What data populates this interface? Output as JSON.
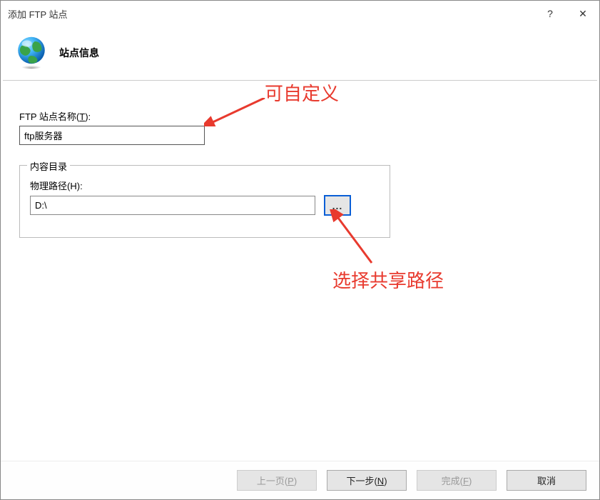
{
  "window": {
    "title": "添加 FTP 站点",
    "help_symbol": "?",
    "close_symbol": "✕"
  },
  "header": {
    "title": "站点信息"
  },
  "fields": {
    "site_name_label_prefix": "FTP 站点名称(",
    "site_name_label_shortcut": "T",
    "site_name_label_suffix": "):",
    "site_name_value": "ftp服务器",
    "content_dir_legend": "内容目录",
    "physical_path_label_prefix": "物理路径(",
    "physical_path_label_shortcut": "H",
    "physical_path_label_suffix": "):",
    "physical_path_value": "D:\\",
    "browse_label": "..."
  },
  "annotations": {
    "customizable": "可自定义",
    "choose_path": "选择共享路径"
  },
  "buttons": {
    "prev_prefix": "上一页(",
    "prev_shortcut": "P",
    "prev_suffix": ")",
    "next_prefix": "下一步(",
    "next_shortcut": "N",
    "next_suffix": ")",
    "finish_prefix": "完成(",
    "finish_shortcut": "F",
    "finish_suffix": ")",
    "cancel": "取消"
  }
}
